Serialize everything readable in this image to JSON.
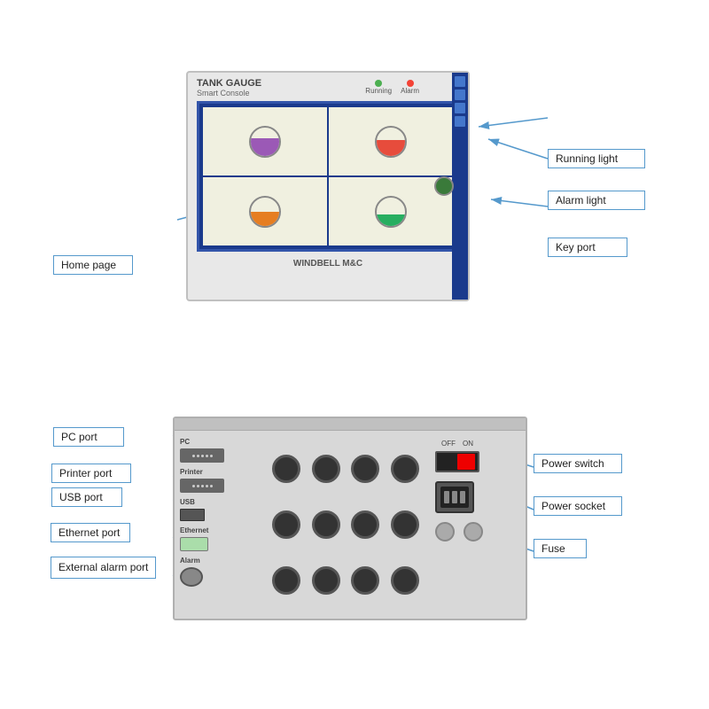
{
  "top_labels": {
    "running_light": "Running light",
    "alarm_light": "Alarm light",
    "key_port": "Key port",
    "home_page": "Home page"
  },
  "bottom_labels": {
    "pc_port": "PC port",
    "printer_port": "Printer port",
    "usb_port": "USB port",
    "ethernet_port": "Ethernet port",
    "external_alarm_port": "External alarm port",
    "power_switch": "Power switch",
    "power_socket": "Power socket",
    "fuse": "Fuse"
  },
  "console": {
    "brand": "TANK GAUGE",
    "sub": "Smart Console",
    "manufacturer": "WINDBELL M&C"
  },
  "colors": {
    "arrow": "#5599cc",
    "border": "#5599cc"
  }
}
